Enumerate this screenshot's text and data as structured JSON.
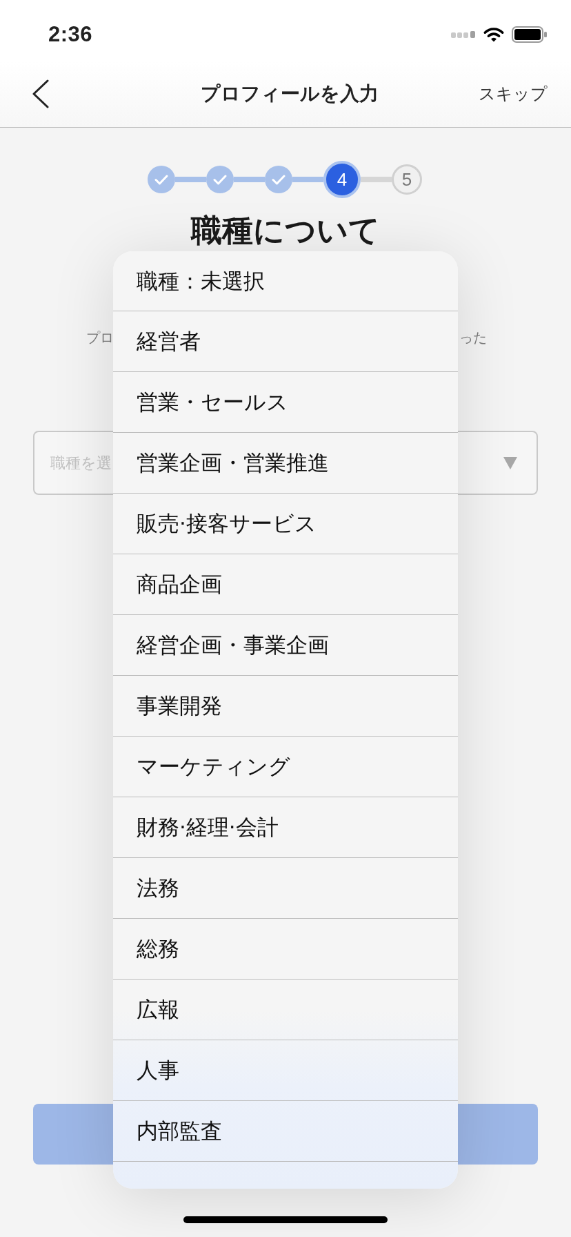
{
  "status_bar": {
    "time": "2:36"
  },
  "nav_bar": {
    "title": "プロフィールを入力",
    "skip": "スキップ"
  },
  "stepper": {
    "steps": [
      {
        "completed": true,
        "selected": false
      },
      {
        "completed": true,
        "selected": false
      },
      {
        "completed": true,
        "selected": false
      },
      {
        "completed": false,
        "selected": true,
        "label": "4"
      },
      {
        "completed": false,
        "selected": false,
        "label": "5"
      }
    ]
  },
  "heading": "職種について",
  "description": {
    "left_part": "プロ",
    "right_part": "った"
  },
  "job_select": {
    "placeholder": "職種を選"
  },
  "dropdown": {
    "options": [
      {
        "label": "職種：未選択"
      },
      {
        "label": "経営者"
      },
      {
        "label": "営業・セールス"
      },
      {
        "label": "営業企画・営業推進"
      },
      {
        "label": "販売·接客サービス"
      },
      {
        "label": "商品企画"
      },
      {
        "label": "経営企画・事業企画"
      },
      {
        "label": "事業開発"
      },
      {
        "label": "マーケティング"
      },
      {
        "label": "財務·経理·会計"
      },
      {
        "label": "法務"
      },
      {
        "label": "総務"
      },
      {
        "label": "広報"
      },
      {
        "label": "人事"
      },
      {
        "label": "内部監査"
      }
    ]
  }
}
